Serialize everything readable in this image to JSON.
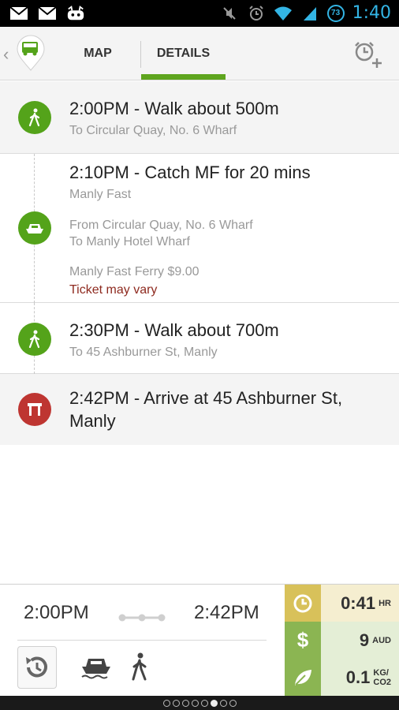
{
  "status_bar": {
    "time": "1:40",
    "battery": "73",
    "left_icons": [
      "gmail-icon",
      "gmail-icon",
      "cyanogen-icon"
    ],
    "right_icons": [
      "mute-icon",
      "alarm-icon",
      "wifi-icon",
      "signal-icon",
      "battery-icon"
    ]
  },
  "action_bar": {
    "tabs": [
      {
        "label": "MAP",
        "selected": false
      },
      {
        "label": "DETAILS",
        "selected": true
      }
    ],
    "accent_color": "#5ea51e"
  },
  "legs": [
    {
      "icon": "walk-icon",
      "title": "2:00PM - Walk about 500m",
      "subtitle": "To Circular Quay, No. 6 Wharf"
    },
    {
      "icon": "ferry-icon",
      "title": "2:10PM - Catch MF for 20 mins",
      "route": "Manly Fast",
      "from": "From Circular Quay, No. 6 Wharf",
      "to": "To Manly Hotel Wharf",
      "fare": "Manly Fast Ferry $9.00",
      "warning": "Ticket may vary"
    },
    {
      "icon": "walk-icon",
      "title": "2:30PM - Walk about 700m",
      "subtitle": "To 45 Ashburner St, Manly"
    },
    {
      "icon": "destination-icon",
      "title_line1": "2:42PM - Arrive at 45 Ashburner St,",
      "title_line2": "Manly"
    }
  ],
  "summary": {
    "start_time": "2:00PM",
    "end_time": "2:42PM",
    "modes": [
      "ferry-icon",
      "walk-icon"
    ],
    "duration_value": "0:41",
    "duration_unit": "HR",
    "cost_value": "9",
    "cost_unit": "AUD",
    "co2_value": "0.1",
    "co2_unit_top": "KG/",
    "co2_unit_bottom": "CO2"
  },
  "pager": {
    "total": 8,
    "current_index": 5
  }
}
